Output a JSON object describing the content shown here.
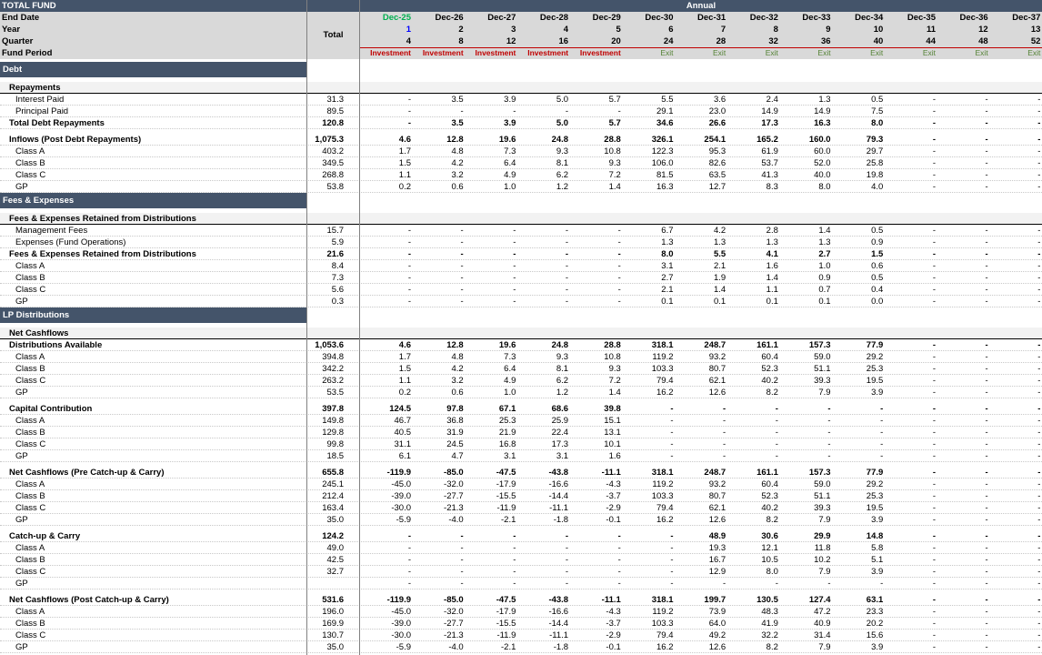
{
  "header": {
    "title": "TOTAL FUND",
    "annual": "Annual",
    "labels": [
      "End Date",
      "Year",
      "Quarter",
      "Fund Period"
    ],
    "total": "Total",
    "columns": [
      {
        "date": "Dec-25",
        "year": "1",
        "quarter": "4",
        "period": "Investment"
      },
      {
        "date": "Dec-26",
        "year": "2",
        "quarter": "8",
        "period": "Investment"
      },
      {
        "date": "Dec-27",
        "year": "3",
        "quarter": "12",
        "period": "Investment"
      },
      {
        "date": "Dec-28",
        "year": "4",
        "quarter": "16",
        "period": "Investment"
      },
      {
        "date": "Dec-29",
        "year": "5",
        "quarter": "20",
        "period": "Investment"
      },
      {
        "date": "Dec-30",
        "year": "6",
        "quarter": "24",
        "period": "Exit"
      },
      {
        "date": "Dec-31",
        "year": "7",
        "quarter": "28",
        "period": "Exit"
      },
      {
        "date": "Dec-32",
        "year": "8",
        "quarter": "32",
        "period": "Exit"
      },
      {
        "date": "Dec-33",
        "year": "9",
        "quarter": "36",
        "period": "Exit"
      },
      {
        "date": "Dec-34",
        "year": "10",
        "quarter": "40",
        "period": "Exit"
      },
      {
        "date": "Dec-35",
        "year": "11",
        "quarter": "44",
        "period": "Exit"
      },
      {
        "date": "Dec-36",
        "year": "12",
        "quarter": "48",
        "period": "Exit"
      },
      {
        "date": "Dec-37",
        "year": "13",
        "quarter": "52",
        "period": "Exit"
      }
    ]
  },
  "rows": [
    {
      "type": "section",
      "label": "Debt"
    },
    {
      "type": "sub",
      "label": "Repayments"
    },
    {
      "type": "item",
      "label": "Interest Paid",
      "total": "31.3",
      "values": [
        "-",
        "3.5",
        "3.9",
        "5.0",
        "5.7",
        "5.5",
        "3.6",
        "2.4",
        "1.3",
        "0.5",
        "-",
        "-",
        "-"
      ]
    },
    {
      "type": "item",
      "label": "Principal Paid",
      "total": "89.5",
      "values": [
        "-",
        "-",
        "-",
        "-",
        "-",
        "29.1",
        "23.0",
        "14.9",
        "14.9",
        "7.5",
        "-",
        "-",
        "-"
      ]
    },
    {
      "type": "boldrow",
      "label": "Total Debt Repayments",
      "total": "120.8",
      "values": [
        "-",
        "3.5",
        "3.9",
        "5.0",
        "5.7",
        "34.6",
        "26.6",
        "17.3",
        "16.3",
        "8.0",
        "-",
        "-",
        "-"
      ]
    },
    {
      "type": "gap"
    },
    {
      "type": "boldrow",
      "label": "Inflows (Post Debt Repayments)",
      "total": "1,075.3",
      "values": [
        "4.6",
        "12.8",
        "19.6",
        "24.8",
        "28.8",
        "326.1",
        "254.1",
        "165.2",
        "160.0",
        "79.3",
        "-",
        "-",
        "-"
      ]
    },
    {
      "type": "item",
      "label": "Class A",
      "total": "403.2",
      "values": [
        "1.7",
        "4.8",
        "7.3",
        "9.3",
        "10.8",
        "122.3",
        "95.3",
        "61.9",
        "60.0",
        "29.7",
        "-",
        "-",
        "-"
      ]
    },
    {
      "type": "item",
      "label": "Class B",
      "total": "349.5",
      "values": [
        "1.5",
        "4.2",
        "6.4",
        "8.1",
        "9.3",
        "106.0",
        "82.6",
        "53.7",
        "52.0",
        "25.8",
        "-",
        "-",
        "-"
      ]
    },
    {
      "type": "item",
      "label": "Class C",
      "total": "268.8",
      "values": [
        "1.1",
        "3.2",
        "4.9",
        "6.2",
        "7.2",
        "81.5",
        "63.5",
        "41.3",
        "40.0",
        "19.8",
        "-",
        "-",
        "-"
      ]
    },
    {
      "type": "item",
      "label": "GP",
      "total": "53.8",
      "values": [
        "0.2",
        "0.6",
        "1.0",
        "1.2",
        "1.4",
        "16.3",
        "12.7",
        "8.3",
        "8.0",
        "4.0",
        "-",
        "-",
        "-"
      ]
    },
    {
      "type": "section",
      "label": "Fees & Expenses"
    },
    {
      "type": "sub",
      "label": "Fees & Expenses Retained from Distributions"
    },
    {
      "type": "item",
      "label": "Management Fees",
      "total": "15.7",
      "values": [
        "-",
        "-",
        "-",
        "-",
        "-",
        "6.7",
        "4.2",
        "2.8",
        "1.4",
        "0.5",
        "-",
        "-",
        "-"
      ]
    },
    {
      "type": "item",
      "label": "Expenses (Fund Operations)",
      "total": "5.9",
      "values": [
        "-",
        "-",
        "-",
        "-",
        "-",
        "1.3",
        "1.3",
        "1.3",
        "1.3",
        "0.9",
        "-",
        "-",
        "-"
      ]
    },
    {
      "type": "boldrow",
      "label": "Fees & Expenses Retained from Distributions",
      "total": "21.6",
      "values": [
        "-",
        "-",
        "-",
        "-",
        "-",
        "8.0",
        "5.5",
        "4.1",
        "2.7",
        "1.5",
        "-",
        "-",
        "-"
      ]
    },
    {
      "type": "item",
      "label": "Class A",
      "total": "8.4",
      "values": [
        "-",
        "-",
        "-",
        "-",
        "-",
        "3.1",
        "2.1",
        "1.6",
        "1.0",
        "0.6",
        "-",
        "-",
        "-"
      ]
    },
    {
      "type": "item",
      "label": "Class B",
      "total": "7.3",
      "values": [
        "-",
        "-",
        "-",
        "-",
        "-",
        "2.7",
        "1.9",
        "1.4",
        "0.9",
        "0.5",
        "-",
        "-",
        "-"
      ]
    },
    {
      "type": "item",
      "label": "Class C",
      "total": "5.6",
      "values": [
        "-",
        "-",
        "-",
        "-",
        "-",
        "2.1",
        "1.4",
        "1.1",
        "0.7",
        "0.4",
        "-",
        "-",
        "-"
      ]
    },
    {
      "type": "item",
      "label": "GP",
      "total": "0.3",
      "values": [
        "-",
        "-",
        "-",
        "-",
        "-",
        "0.1",
        "0.1",
        "0.1",
        "0.1",
        "0.0",
        "-",
        "-",
        "-"
      ]
    },
    {
      "type": "section",
      "label": "LP Distributions"
    },
    {
      "type": "sub",
      "label": "Net Cashflows"
    },
    {
      "type": "boldrow",
      "label": "Distributions Available",
      "total": "1,053.6",
      "values": [
        "4.6",
        "12.8",
        "19.6",
        "24.8",
        "28.8",
        "318.1",
        "248.7",
        "161.1",
        "157.3",
        "77.9",
        "-",
        "-",
        "-"
      ]
    },
    {
      "type": "item",
      "label": "Class A",
      "total": "394.8",
      "values": [
        "1.7",
        "4.8",
        "7.3",
        "9.3",
        "10.8",
        "119.2",
        "93.2",
        "60.4",
        "59.0",
        "29.2",
        "-",
        "-",
        "-"
      ]
    },
    {
      "type": "item",
      "label": "Class B",
      "total": "342.2",
      "values": [
        "1.5",
        "4.2",
        "6.4",
        "8.1",
        "9.3",
        "103.3",
        "80.7",
        "52.3",
        "51.1",
        "25.3",
        "-",
        "-",
        "-"
      ]
    },
    {
      "type": "item",
      "label": "Class C",
      "total": "263.2",
      "values": [
        "1.1",
        "3.2",
        "4.9",
        "6.2",
        "7.2",
        "79.4",
        "62.1",
        "40.2",
        "39.3",
        "19.5",
        "-",
        "-",
        "-"
      ]
    },
    {
      "type": "item",
      "label": "GP",
      "total": "53.5",
      "values": [
        "0.2",
        "0.6",
        "1.0",
        "1.2",
        "1.4",
        "16.2",
        "12.6",
        "8.2",
        "7.9",
        "3.9",
        "-",
        "-",
        "-"
      ]
    },
    {
      "type": "gap"
    },
    {
      "type": "boldrow",
      "label": "Capital Contribution",
      "total": "397.8",
      "values": [
        "124.5",
        "97.8",
        "67.1",
        "68.6",
        "39.8",
        "-",
        "-",
        "-",
        "-",
        "-",
        "-",
        "-",
        "-"
      ]
    },
    {
      "type": "item",
      "label": "Class A",
      "total": "149.8",
      "values": [
        "46.7",
        "36.8",
        "25.3",
        "25.9",
        "15.1",
        "-",
        "-",
        "-",
        "-",
        "-",
        "-",
        "-",
        "-"
      ]
    },
    {
      "type": "item",
      "label": "Class B",
      "total": "129.8",
      "values": [
        "40.5",
        "31.9",
        "21.9",
        "22.4",
        "13.1",
        "-",
        "-",
        "-",
        "-",
        "-",
        "-",
        "-",
        "-"
      ]
    },
    {
      "type": "item",
      "label": "Class C",
      "total": "99.8",
      "values": [
        "31.1",
        "24.5",
        "16.8",
        "17.3",
        "10.1",
        "-",
        "-",
        "-",
        "-",
        "-",
        "-",
        "-",
        "-"
      ]
    },
    {
      "type": "item",
      "label": "GP",
      "total": "18.5",
      "values": [
        "6.1",
        "4.7",
        "3.1",
        "3.1",
        "1.6",
        "-",
        "-",
        "-",
        "-",
        "-",
        "-",
        "-",
        "-"
      ]
    },
    {
      "type": "gap"
    },
    {
      "type": "boldrow",
      "label": "Net Cashflows (Pre Catch-up & Carry)",
      "total": "655.8",
      "values": [
        "-119.9",
        "-85.0",
        "-47.5",
        "-43.8",
        "-11.1",
        "318.1",
        "248.7",
        "161.1",
        "157.3",
        "77.9",
        "-",
        "-",
        "-"
      ]
    },
    {
      "type": "item",
      "label": "Class A",
      "total": "245.1",
      "values": [
        "-45.0",
        "-32.0",
        "-17.9",
        "-16.6",
        "-4.3",
        "119.2",
        "93.2",
        "60.4",
        "59.0",
        "29.2",
        "-",
        "-",
        "-"
      ]
    },
    {
      "type": "item",
      "label": "Class B",
      "total": "212.4",
      "values": [
        "-39.0",
        "-27.7",
        "-15.5",
        "-14.4",
        "-3.7",
        "103.3",
        "80.7",
        "52.3",
        "51.1",
        "25.3",
        "-",
        "-",
        "-"
      ]
    },
    {
      "type": "item",
      "label": "Class C",
      "total": "163.4",
      "values": [
        "-30.0",
        "-21.3",
        "-11.9",
        "-11.1",
        "-2.9",
        "79.4",
        "62.1",
        "40.2",
        "39.3",
        "19.5",
        "-",
        "-",
        "-"
      ]
    },
    {
      "type": "item",
      "label": "GP",
      "total": "35.0",
      "values": [
        "-5.9",
        "-4.0",
        "-2.1",
        "-1.8",
        "-0.1",
        "16.2",
        "12.6",
        "8.2",
        "7.9",
        "3.9",
        "-",
        "-",
        "-"
      ]
    },
    {
      "type": "gap"
    },
    {
      "type": "boldrow",
      "label": "Catch-up & Carry",
      "total": "124.2",
      "values": [
        "-",
        "-",
        "-",
        "-",
        "-",
        "-",
        "48.9",
        "30.6",
        "29.9",
        "14.8",
        "-",
        "-",
        "-"
      ]
    },
    {
      "type": "item",
      "label": "Class A",
      "total": "49.0",
      "values": [
        "-",
        "-",
        "-",
        "-",
        "-",
        "-",
        "19.3",
        "12.1",
        "11.8",
        "5.8",
        "-",
        "-",
        "-"
      ]
    },
    {
      "type": "item",
      "label": "Class B",
      "total": "42.5",
      "values": [
        "-",
        "-",
        "-",
        "-",
        "-",
        "-",
        "16.7",
        "10.5",
        "10.2",
        "5.1",
        "-",
        "-",
        "-"
      ]
    },
    {
      "type": "item",
      "label": "Class C",
      "total": "32.7",
      "values": [
        "-",
        "-",
        "-",
        "-",
        "-",
        "-",
        "12.9",
        "8.0",
        "7.9",
        "3.9",
        "-",
        "-",
        "-"
      ]
    },
    {
      "type": "item",
      "label": "GP",
      "total": "",
      "values": [
        "-",
        "-",
        "-",
        "-",
        "-",
        "-",
        "-",
        "-",
        "-",
        "-",
        "-",
        "-",
        "-"
      ]
    },
    {
      "type": "gap"
    },
    {
      "type": "boldrow",
      "label": "Net Cashflows (Post Catch-up & Carry)",
      "total": "531.6",
      "values": [
        "-119.9",
        "-85.0",
        "-47.5",
        "-43.8",
        "-11.1",
        "318.1",
        "199.7",
        "130.5",
        "127.4",
        "63.1",
        "-",
        "-",
        "-"
      ]
    },
    {
      "type": "item",
      "label": "Class A",
      "total": "196.0",
      "values": [
        "-45.0",
        "-32.0",
        "-17.9",
        "-16.6",
        "-4.3",
        "119.2",
        "73.9",
        "48.3",
        "47.2",
        "23.3",
        "-",
        "-",
        "-"
      ]
    },
    {
      "type": "item",
      "label": "Class B",
      "total": "169.9",
      "values": [
        "-39.0",
        "-27.7",
        "-15.5",
        "-14.4",
        "-3.7",
        "103.3",
        "64.0",
        "41.9",
        "40.9",
        "20.2",
        "-",
        "-",
        "-"
      ]
    },
    {
      "type": "item",
      "label": "Class C",
      "total": "130.7",
      "values": [
        "-30.0",
        "-21.3",
        "-11.9",
        "-11.1",
        "-2.9",
        "79.4",
        "49.2",
        "32.2",
        "31.4",
        "15.6",
        "-",
        "-",
        "-"
      ]
    },
    {
      "type": "item",
      "label": "GP",
      "total": "35.0",
      "values": [
        "-5.9",
        "-4.0",
        "-2.1",
        "-1.8",
        "-0.1",
        "16.2",
        "12.6",
        "8.2",
        "7.9",
        "3.9",
        "-",
        "-",
        "-"
      ]
    }
  ],
  "colors": {
    "section": "#44546a",
    "header": "#d9d9d9",
    "investment": "#c00000",
    "exit": "#548235",
    "year": "#0000ff",
    "firstdate": "#00b050"
  }
}
